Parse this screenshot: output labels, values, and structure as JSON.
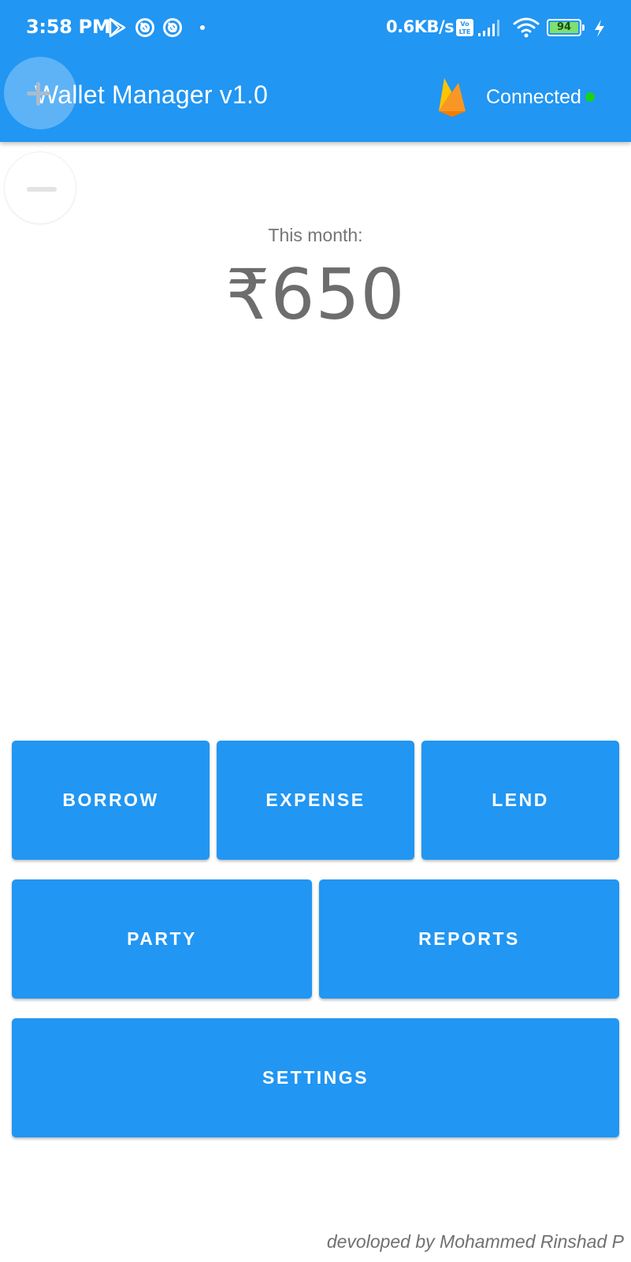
{
  "status_bar": {
    "time": "3:58 PM",
    "notification_icons": [
      "play-store-icon",
      "app-notification-icon",
      "app-notification-icon",
      "dot-icon"
    ],
    "network_speed": "0.6KB/s",
    "volte_label": "Vo LTE",
    "battery_level": "94",
    "charging": true
  },
  "app_bar": {
    "title": "Wallet Manager v1.0",
    "connection_status": "Connected",
    "connection_color": "#19d319",
    "brand_icon": "firebase-icon"
  },
  "zoom": {
    "in_icon": "plus-icon",
    "out_icon": "minus-icon"
  },
  "summary": {
    "label": "This month:",
    "amount": "₹650"
  },
  "actions": {
    "borrow": "BORROW",
    "expense": "EXPENSE",
    "lend": "LEND",
    "party": "PARTY",
    "reports": "REPORTS",
    "settings": "SETTINGS"
  },
  "footer": {
    "credit": "devoloped by Mohammed Rinshad P"
  },
  "colors": {
    "primary": "#2196f3",
    "amount_text": "#6d6d6d"
  }
}
